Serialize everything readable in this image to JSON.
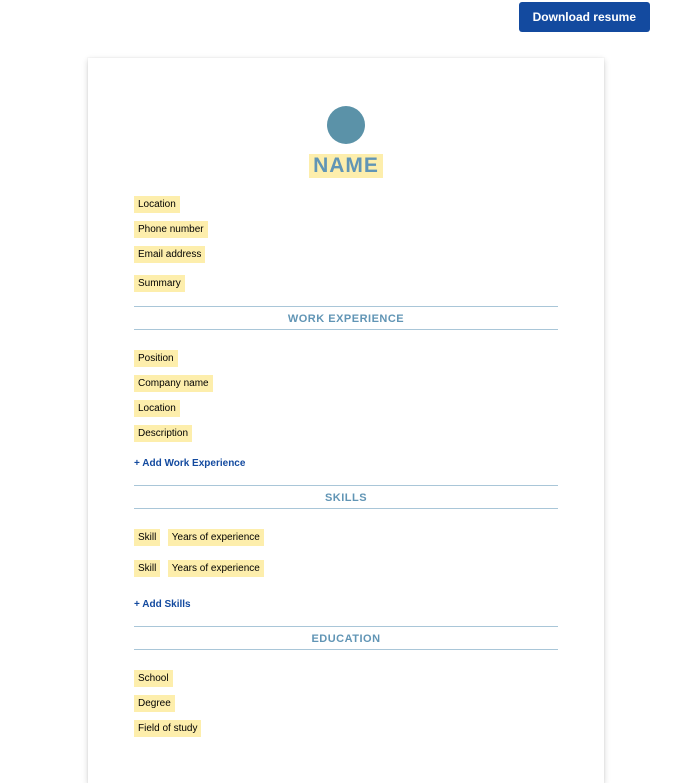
{
  "topbar": {
    "download_label": "Download resume"
  },
  "resume": {
    "name_placeholder": "NAME",
    "personal": {
      "location": "Location",
      "phone": "Phone number",
      "email": "Email address",
      "summary": "Summary"
    },
    "sections": {
      "work": {
        "heading": "WORK EXPERIENCE",
        "entry": {
          "position": "Position",
          "company": "Company name",
          "location": "Location",
          "description": "Description"
        },
        "add_label": "+ Add Work Experience"
      },
      "skills": {
        "heading": "SKILLS",
        "rows": [
          {
            "skill": "Skill",
            "years": "Years of experience"
          },
          {
            "skill": "Skill",
            "years": "Years of experience"
          }
        ],
        "add_label": "+ Add Skills"
      },
      "education": {
        "heading": "EDUCATION",
        "entry": {
          "school": "School",
          "degree": "Degree",
          "field": "Field of study"
        }
      }
    }
  }
}
